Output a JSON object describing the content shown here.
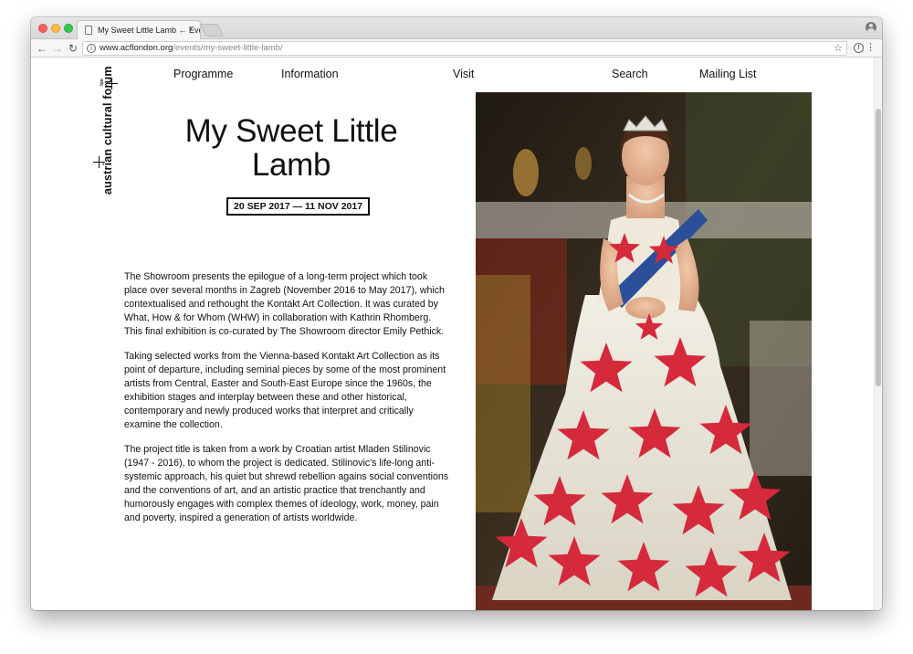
{
  "browser": {
    "tab_title": "My Sweet Little Lamb ← Events",
    "tab_close": "×",
    "url_domain": "www.acflondon.org",
    "url_path": "/events/my-sweet-little-lamb/",
    "icons": [
      "back-arrow-icon",
      "forward-arrow-icon",
      "reload-icon",
      "info-icon",
      "star-icon",
      "extension-icon",
      "menu-icon",
      "profile-icon"
    ]
  },
  "site": {
    "logo_text": "austrian cultural forum",
    "logo_mini": "lon",
    "nav": [
      "Programme",
      "Information",
      "Visit",
      "Search",
      "Mailing List"
    ]
  },
  "event": {
    "title": "My Sweet Little Lamb",
    "dates": "20 SEP 2017 — 11 NOV 2017",
    "paragraphs": [
      "The Showroom presents the epilogue of a long-term project which took place over several months in Zagreb (November 2016 to May 2017), which contextualised and rethought the Kontakt Art Collection. It was curated by What, How & for Whom (WHW) in collaboration with Kathrin Rhomberg. This final exhibition is co-curated by The Showroom director Emily Pethick.",
      "Taking selected works from the Vienna-based Kontakt Art Collection as its point of departure, including seminal pieces by some of the most prominent artists from Central, Easter and South-East Europe since the 1960s, the exhibition stages and interplay between these and other historical, contemporary and newly produced works that interpret and critically examine the collection.",
      "The project title is taken from a work by Croatian artist Mladen Stilinovic (1947 - 2016), to whom the project is dedicated. Stilinovic's life-long anti-systemic approach, his quiet but shrewd rebellion agains social conventions and the conventions of art, and an artistic practice that trenchantly and humorously engages with complex themes of ideology, work, money, pain and poverty, inspired a generation of artists worldwide."
    ]
  },
  "colors": {
    "star_red": "#d42a3c",
    "sash_blue": "#2c4f9a",
    "gown_white": "#ebe8dc",
    "backdrop_dark": "#2e261c"
  }
}
